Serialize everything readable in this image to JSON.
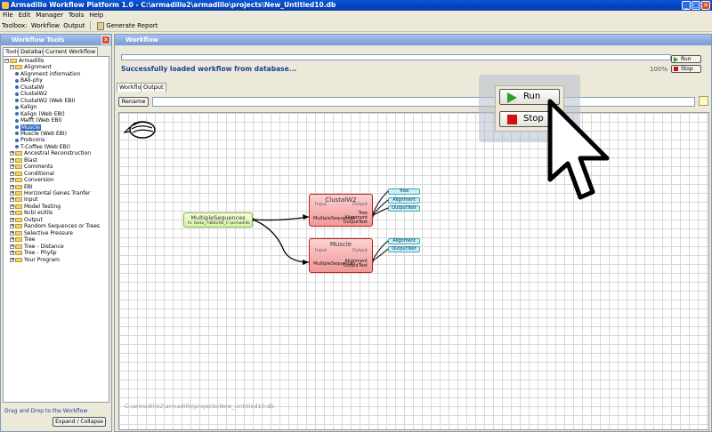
{
  "window": {
    "title": "Armadillo Workflow Platform 1.0 - C:\\armadillo2\\armadillo\\projects\\New_Untitled10.db",
    "minimize": "_",
    "maximize": "□",
    "close": "✕"
  },
  "menu": [
    "File",
    "Edit",
    "Manager",
    "Tools",
    "Help"
  ],
  "toolbar": {
    "label": "Toolbox:",
    "workflow": "Workflow",
    "output": "Output",
    "generate_report": "Generate Report"
  },
  "left_panel": {
    "title": "Workflow Tools",
    "close": "✕",
    "tabs": [
      "Tools",
      "Database",
      "Current Workflow"
    ],
    "tree": [
      {
        "label": "Armadillo",
        "level": 0,
        "type": "folder",
        "expanded": true
      },
      {
        "label": "Alignment",
        "level": 1,
        "type": "folder",
        "expanded": true
      },
      {
        "label": "Alignment information",
        "level": 2,
        "type": "leaf"
      },
      {
        "label": "BAli-phy",
        "level": 2,
        "type": "leaf"
      },
      {
        "label": "ClustalW",
        "level": 2,
        "type": "leaf"
      },
      {
        "label": "ClustalW2",
        "level": 2,
        "type": "leaf"
      },
      {
        "label": "ClustalW2 (Web EBI)",
        "level": 2,
        "type": "leaf"
      },
      {
        "label": "Kalign",
        "level": 2,
        "type": "leaf"
      },
      {
        "label": "Kalign (Web EBI)",
        "level": 2,
        "type": "leaf"
      },
      {
        "label": "Mafft (Web EBI)",
        "level": 2,
        "type": "leaf"
      },
      {
        "label": "Muscle",
        "level": 2,
        "type": "leaf",
        "selected": true
      },
      {
        "label": "Muscle (Web EBI)",
        "level": 2,
        "type": "leaf"
      },
      {
        "label": "Probcons",
        "level": 2,
        "type": "leaf"
      },
      {
        "label": "T-Coffee (Web EBI)",
        "level": 2,
        "type": "leaf"
      },
      {
        "label": "Ancestral Reconstruction",
        "level": 1,
        "type": "folder"
      },
      {
        "label": "Blast",
        "level": 1,
        "type": "folder"
      },
      {
        "label": "Comments",
        "level": 1,
        "type": "folder"
      },
      {
        "label": "Conditional",
        "level": 1,
        "type": "folder"
      },
      {
        "label": "Conversion",
        "level": 1,
        "type": "folder"
      },
      {
        "label": "EBI",
        "level": 1,
        "type": "folder"
      },
      {
        "label": "Horizontal Genes Tranfer",
        "level": 1,
        "type": "folder"
      },
      {
        "label": "Input",
        "level": 1,
        "type": "folder"
      },
      {
        "label": "Model Testing",
        "level": 1,
        "type": "folder"
      },
      {
        "label": "Ncbi eUtils",
        "level": 1,
        "type": "folder"
      },
      {
        "label": "Output",
        "level": 1,
        "type": "folder"
      },
      {
        "label": "Random Sequences or Trees",
        "level": 1,
        "type": "folder"
      },
      {
        "label": "Selective Pressure",
        "level": 1,
        "type": "folder"
      },
      {
        "label": "Tree",
        "level": 1,
        "type": "folder"
      },
      {
        "label": "Tree - Distance",
        "level": 1,
        "type": "folder"
      },
      {
        "label": "Tree - Phylip",
        "level": 1,
        "type": "folder"
      },
      {
        "label": "Your Program",
        "level": 1,
        "type": "folder"
      }
    ],
    "drag_hint": "Drag and Drop to the Workflow",
    "expand_collapse": "Expand / Collapse"
  },
  "right_panel": {
    "title": "Workflow",
    "status": "Successfully loaded workflow from database...",
    "percent": "100%",
    "progress": 0,
    "run": "Run",
    "stop": "Stop",
    "tabs": [
      "Workflow",
      "Output"
    ],
    "rename": "Rename",
    "name_value": "",
    "canvas_path": "C:\\armadillo2\\armadillo\\projects\\New_Untitled10.db"
  },
  "workflow": {
    "input_node": {
      "title": "MultipleSequences",
      "subtitle": "fs: fasta_7484206_C:\\armadillo"
    },
    "clustalw2": {
      "title": "ClustalW2",
      "input_label": "Input",
      "output_label": "Output",
      "in_port": "MultipleSequences",
      "out_ports": [
        "Tree",
        "Alignment",
        "OutputText"
      ]
    },
    "muscle": {
      "title": "Muscle",
      "input_label": "Input",
      "output_label": "Output",
      "in_port": "MultipleSequences",
      "out_ports": [
        "Alignment",
        "OutputText"
      ]
    }
  },
  "overlay": {
    "run": "Run",
    "stop": "Stop"
  },
  "colors": {
    "accent": "#0a58d8",
    "status_text": "#1a3fa0",
    "node_red": "#f29898",
    "node_green": "#d8f4a8",
    "output_cyan": "#cdeefa"
  }
}
